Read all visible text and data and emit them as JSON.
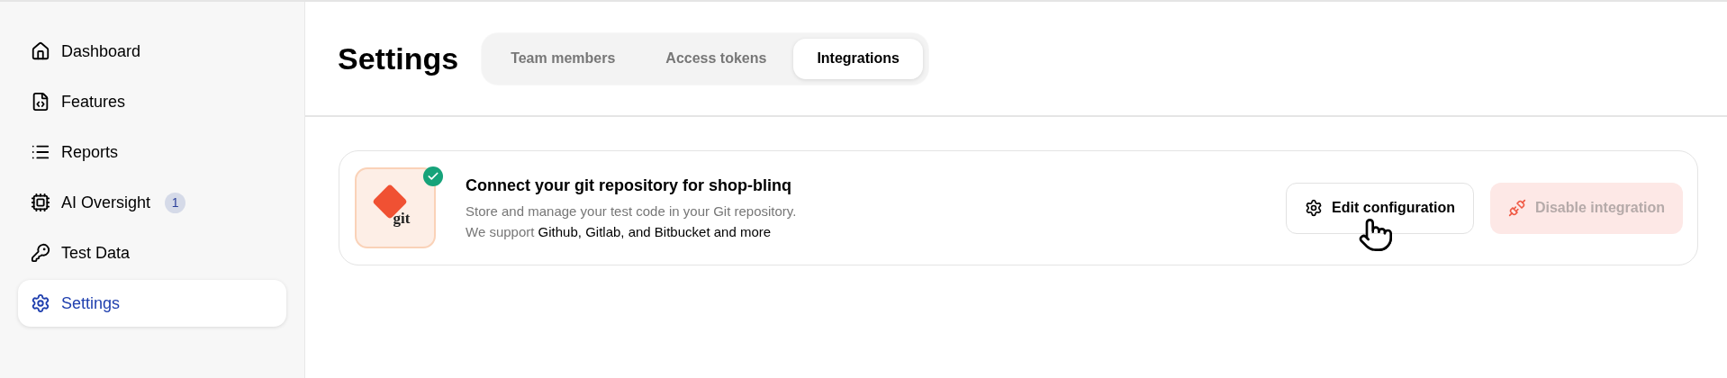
{
  "sidebar": {
    "items": [
      {
        "label": "Dashboard",
        "kind": "home",
        "selected": false
      },
      {
        "label": "Features",
        "kind": "features",
        "selected": false
      },
      {
        "label": "Reports",
        "kind": "reports",
        "selected": false
      },
      {
        "label": "AI Oversight",
        "kind": "ai",
        "selected": false,
        "badge": "1"
      },
      {
        "label": "Test Data",
        "kind": "data",
        "selected": false
      },
      {
        "label": "Settings",
        "kind": "settings",
        "selected": true
      }
    ]
  },
  "header": {
    "title": "Settings",
    "tabs": [
      {
        "label": "Team members",
        "selected": false
      },
      {
        "label": "Access tokens",
        "selected": false
      },
      {
        "label": "Integrations",
        "selected": true
      }
    ]
  },
  "integration": {
    "logo_text": "git",
    "connected": true,
    "title": "Connect your git repository for shop-blinq",
    "description": "Store and manage your test code in your Git repository.",
    "support": {
      "lead": "We support",
      "highlight": "Github, Gitlab, and Bitbucket and more"
    },
    "buttons": [
      {
        "label": "Edit configuration",
        "kind": "edit",
        "disabled": false
      },
      {
        "label": "Disable integration",
        "kind": "disable",
        "disabled": true
      }
    ]
  }
}
